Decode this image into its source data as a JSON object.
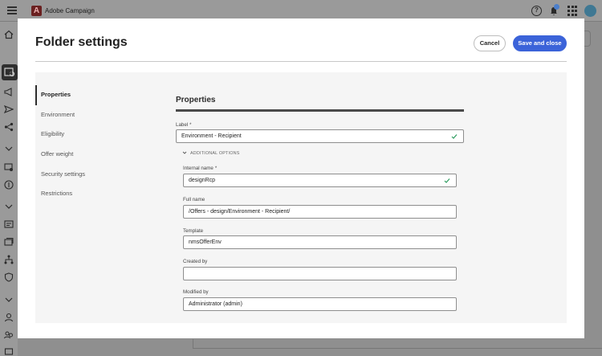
{
  "app": {
    "name": "Adobe Campaign",
    "logo_letter": "A"
  },
  "modal": {
    "title": "Folder settings",
    "cancel_label": "Cancel",
    "save_label": "Save and close"
  },
  "nav": {
    "items": [
      {
        "label": "Properties",
        "active": true
      },
      {
        "label": "Environment",
        "active": false
      },
      {
        "label": "Eligibility",
        "active": false
      },
      {
        "label": "Offer weight",
        "active": false
      },
      {
        "label": "Security settings",
        "active": false
      },
      {
        "label": "Restrictions",
        "active": false
      }
    ]
  },
  "properties": {
    "title": "Properties",
    "label_field": {
      "label": "Label",
      "value": "Environment - Recipient",
      "required": true
    },
    "additional_options": "ADDITIONAL OPTIONS",
    "internal_name": {
      "label": "Internal name",
      "value": "designRcp",
      "required": true
    },
    "full_name": {
      "label": "Full name",
      "value": "/Offers - design/Environment - Recipient/"
    },
    "template": {
      "label": "Template",
      "value": "nmsOfferEnv"
    },
    "created_by": {
      "label": "Created by",
      "value": ""
    },
    "modified_by": {
      "label": "Modified by",
      "value": "Administrator (admin)"
    }
  },
  "colors": {
    "primary": "#3b63d9",
    "valid": "#2d9c5f",
    "text": "#222222"
  }
}
